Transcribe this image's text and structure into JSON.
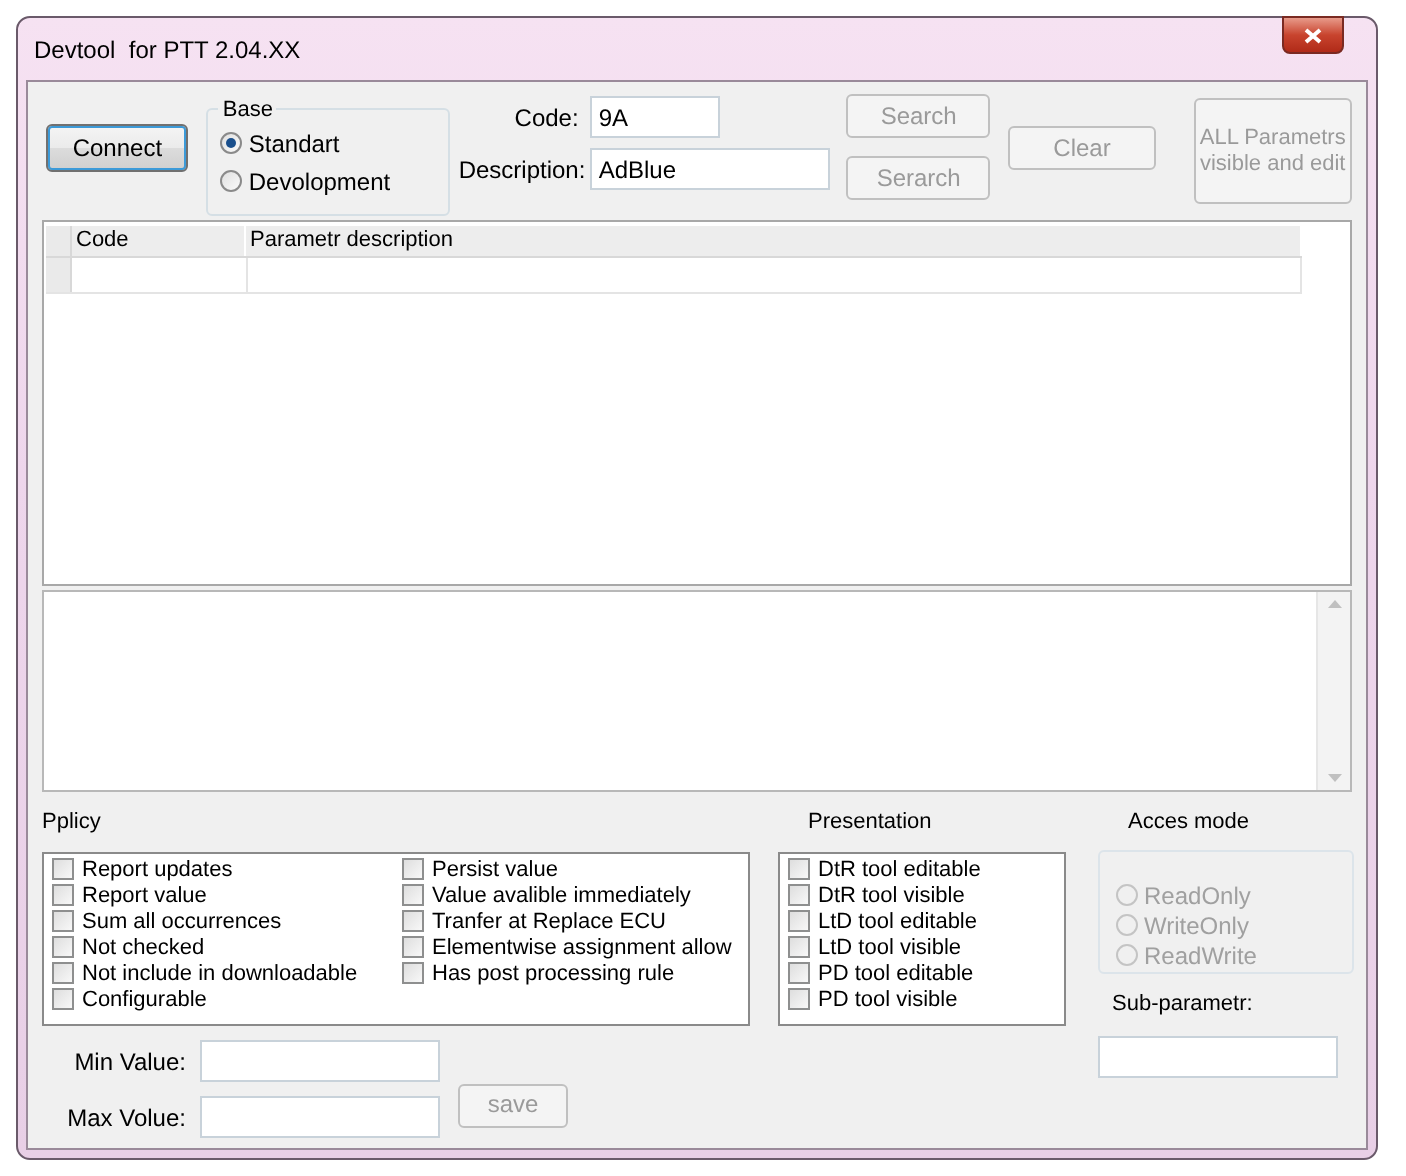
{
  "window": {
    "title": "Devtool  for PTT 2.04.XX"
  },
  "connect_button": {
    "label": "Connect",
    "disabled": false
  },
  "base": {
    "label": "Base",
    "options": [
      {
        "label": "Standart",
        "selected": true,
        "disabled": false
      },
      {
        "label": "Devolopment",
        "selected": false,
        "disabled": false
      }
    ]
  },
  "code": {
    "label": "Code:",
    "value": "9A"
  },
  "description": {
    "label": "Description:",
    "value": "AdBlue"
  },
  "search_buttons": [
    {
      "label": "Search",
      "disabled": true
    },
    {
      "label": "Serarch",
      "disabled": true
    }
  ],
  "clear_button": {
    "label": "Clear",
    "disabled": true
  },
  "all_params_button": {
    "label": "ALL Parametrs visible and edit",
    "disabled": true
  },
  "table": {
    "columns": [
      "Code",
      "Parametr description"
    ]
  },
  "policy": {
    "label": "Pplicy",
    "columns": [
      [
        {
          "label": "Report updates",
          "checked": false
        },
        {
          "label": "Report value",
          "checked": false
        },
        {
          "label": "Sum all occurrences",
          "checked": false
        },
        {
          "label": "Not checked",
          "checked": false
        },
        {
          "label": "Not include in downloadable",
          "checked": false
        },
        {
          "label": "Configurable",
          "checked": false
        }
      ],
      [
        {
          "label": "Persist value",
          "checked": false
        },
        {
          "label": "Value avalible immediately",
          "checked": false
        },
        {
          "label": "Tranfer at Replace ECU",
          "checked": false
        },
        {
          "label": "Elementwise assignment allow",
          "checked": false
        },
        {
          "label": "Has post processing rule",
          "checked": false
        }
      ]
    ]
  },
  "presentation": {
    "label": "Presentation",
    "items": [
      {
        "label": "DtR tool editable",
        "checked": false
      },
      {
        "label": "DtR tool visible",
        "checked": false
      },
      {
        "label": "LtD tool editable",
        "checked": false
      },
      {
        "label": "LtD tool visible",
        "checked": false
      },
      {
        "label": "PD tool editable",
        "checked": false
      },
      {
        "label": "PD tool visible",
        "checked": false
      }
    ]
  },
  "access_mode": {
    "label": "Acces mode",
    "options": [
      {
        "label": "ReadOnly",
        "selected": false,
        "disabled": true
      },
      {
        "label": "WriteOnly",
        "selected": false,
        "disabled": true
      },
      {
        "label": "ReadWrite",
        "selected": false,
        "disabled": true
      }
    ]
  },
  "sub_parameter": {
    "label": "Sub-parametr:"
  },
  "min_value": {
    "label": "Min Value:"
  },
  "max_value": {
    "label": "Max Volue:"
  },
  "save_button": {
    "label": "save",
    "disabled": true
  }
}
